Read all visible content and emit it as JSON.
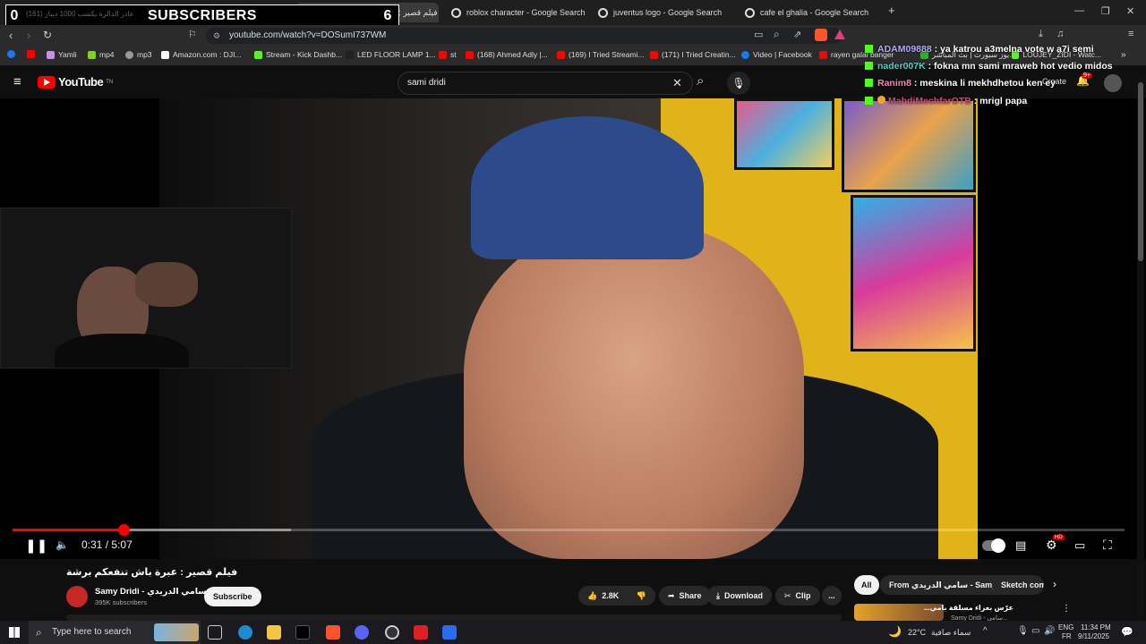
{
  "browser": {
    "tabs": [
      {
        "label": "(161) فيلم قصير : عبرة باش تتفعكم"
      },
      {
        "label": "roblox character - Google Search"
      },
      {
        "label": "juventus logo - Google Search"
      },
      {
        "label": "cafe el ghalia - Google Search"
      }
    ],
    "new_tab": "+",
    "url": "youtube.com/watch?v=DOSumI737WM",
    "bookmarks": [
      "Yamli",
      "mp4",
      "mp3",
      "Amazon.com : DJI...",
      "Stream - Kick Dashb...",
      "LED FLOOR LAMP 1...",
      "st",
      "(168) Ahmed Adly |...",
      "(169) I Tried Streami...",
      "(171) I Tried Creatin...",
      "Video | Facebook",
      "rayen galai banger",
      "يوز سبورت | بث المباشر...",
      "LOUJEY_ZIDI - Watc..."
    ]
  },
  "overlay": {
    "left_count": "0",
    "label": "SUBSCRIBERS",
    "right_count": "6",
    "ghost_text": "(161) ‫عادر الدالرة يكسب 1000 دينار‬"
  },
  "chat": [
    {
      "user": "ADAM09888",
      "msg": ": ya katrou a3melna vote w a7i semi",
      "color": "#b7a4ff"
    },
    {
      "user": "nader007K",
      "msg": ": fokna mn sami mraweb hot vedio midos",
      "color": "#4fd1c5"
    },
    {
      "user": "Ranim8",
      "msg": ": meskina li mekhdhetou ken ey",
      "color": "#ff7eb6"
    },
    {
      "user": "MahdiMechfarOTB",
      "msg": ": mrigl papa",
      "color": "#e0407a"
    }
  ],
  "youtube": {
    "logo": "YouTube",
    "logo_sup": "TN",
    "search_value": "sami dridi",
    "notif_count": "9+",
    "create_label": "Create",
    "time_current": "0:31",
    "time_sep": "/",
    "time_total": "5:07",
    "progress_fraction": 0.1,
    "buffer_fraction": 0.25,
    "video_title": "فيلم قصير : عبرة باش تنفعكم برشة",
    "channel_name": "Samy Dridi - سامي الدريدي",
    "subscribers": "395K subscribers",
    "subscribe_label": "Subscribe",
    "likes": "2.8K",
    "share_label": "Share",
    "download_label": "Download",
    "clip_label": "Clip",
    "more_label": "...",
    "chips": [
      "All",
      "From سامي الدريدي - Samy Dridi",
      "Sketch come"
    ],
    "suggested_title": "عرّس بعراء مسلقة بامي...",
    "suggested_channel": "Samy Dridi - سامي..."
  },
  "taskbar": {
    "search_placeholder": "Type here to search",
    "weather": "22°C",
    "weather_text": "سماء صافية",
    "lang": "ENG",
    "lang2": "FR",
    "time": "11:34 PM",
    "date": "9/11/2025"
  },
  "colors": {
    "accent_red": "#ff0000",
    "kick_green": "#53fc18"
  }
}
